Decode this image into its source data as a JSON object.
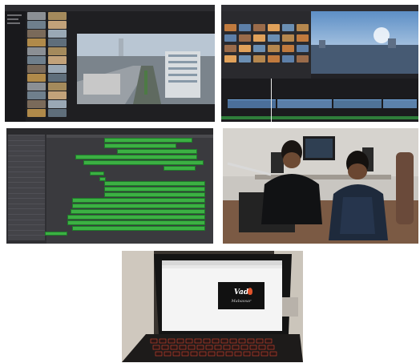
{
  "panels": [
    {
      "id": "imovie-browser",
      "kind": "screenshot"
    },
    {
      "id": "imovie-timeline",
      "kind": "screenshot"
    },
    {
      "id": "logic-pro-arrangement",
      "kind": "screenshot"
    },
    {
      "id": "studio-photo",
      "kind": "photo"
    },
    {
      "id": "laptop-photo",
      "kind": "photo"
    }
  ],
  "laptop_screen": {
    "logo_text": "Vad",
    "logo_subtext": "Mabassar",
    "logo_colors": {
      "background": "#111111",
      "text": "#ffffff",
      "flame": "#e0532b"
    }
  },
  "colors": {
    "app_dark": "#1f1f22",
    "region_green": "#3cb043",
    "clip_blue": "#6fa3d8",
    "keyboard_backlight": "#d8452f"
  },
  "icons": [
    "flame-icon"
  ]
}
